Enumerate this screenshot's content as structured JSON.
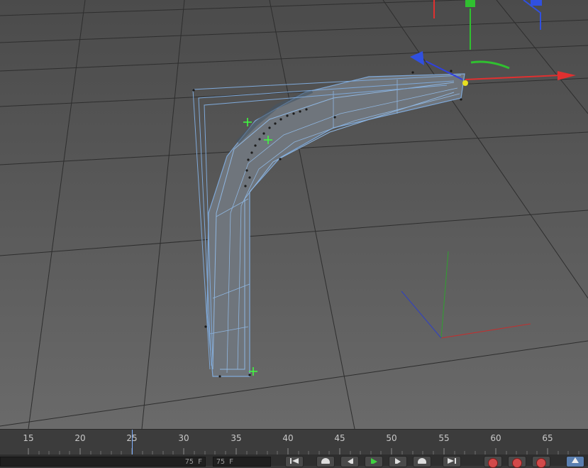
{
  "viewport": {
    "name": "3D viewport",
    "colors": {
      "mesh_wire": "#7fa9d9",
      "axis_x": "#e03030",
      "axis_y": "#30c030",
      "axis_z": "#3050e0",
      "point_highlight": "#e8e020",
      "handle": "#40ff40"
    }
  },
  "timeline": {
    "ticks": [
      "15",
      "20",
      "25",
      "30",
      "35",
      "40",
      "45",
      "50",
      "55",
      "60",
      "65"
    ]
  },
  "transport": {
    "start_field": "75 F",
    "end_field": "75 F",
    "buttons": [
      {
        "icon": "go-to-start-icon"
      },
      {
        "icon": "previous-keyframe-icon"
      },
      {
        "icon": "step-back-icon"
      },
      {
        "icon": "play-icon"
      },
      {
        "icon": "step-forward-icon"
      },
      {
        "icon": "next-keyframe-icon"
      },
      {
        "icon": "go-to-end-icon"
      }
    ],
    "record_buttons": [
      {
        "icon": "record-active-objects-icon"
      },
      {
        "icon": "autokeying-icon"
      },
      {
        "icon": "keyframe-selection-icon"
      }
    ]
  }
}
